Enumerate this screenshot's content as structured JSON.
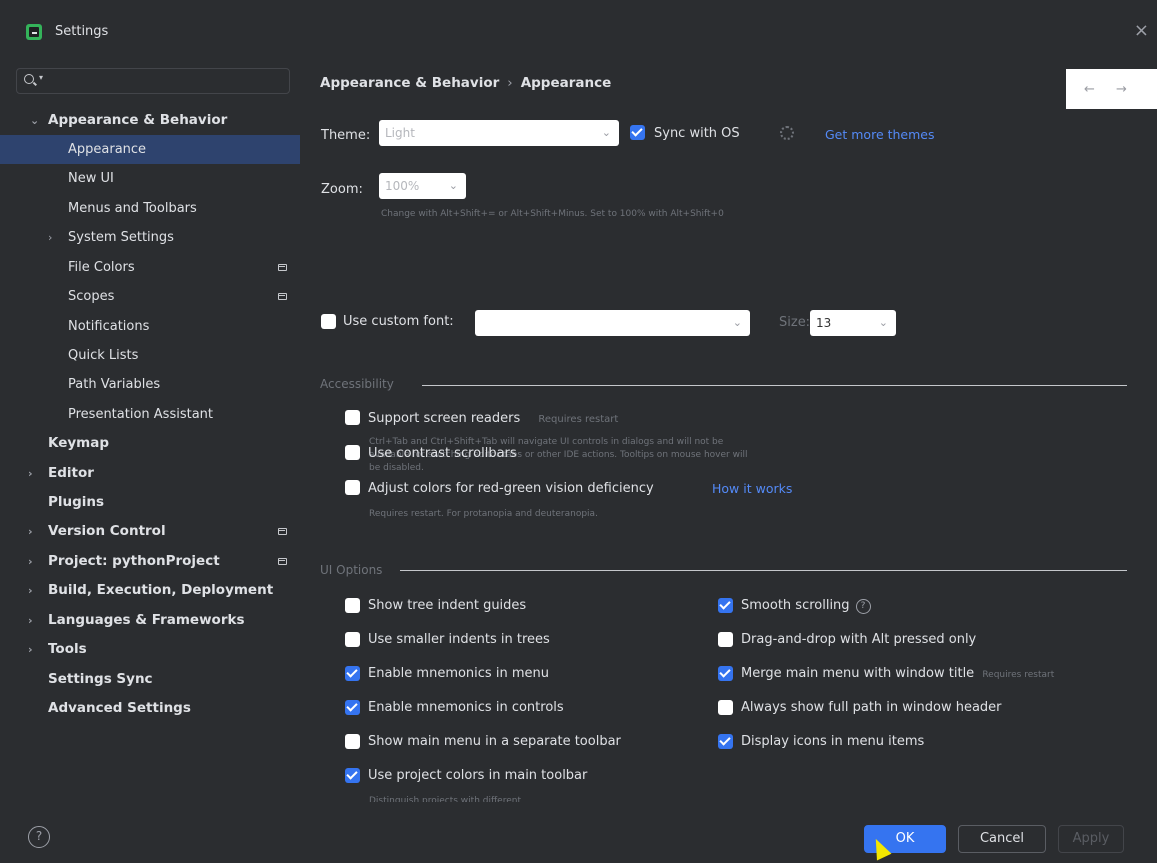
{
  "window": {
    "title": "Settings",
    "close_glyph": "×"
  },
  "sidebar": {
    "search_placeholder": "",
    "search_value": "",
    "items": [
      {
        "label": "Appearance & Behavior",
        "level": 0,
        "chevron": "expanded"
      },
      {
        "label": "Appearance",
        "level": 1,
        "selected": true
      },
      {
        "label": "New UI",
        "level": 1
      },
      {
        "label": "Menus and Toolbars",
        "level": 1
      },
      {
        "label": "System Settings",
        "level": 1,
        "chevron": "collapsed"
      },
      {
        "label": "File Colors",
        "level": 1,
        "scope_icon": true
      },
      {
        "label": "Scopes",
        "level": 1,
        "scope_icon": true
      },
      {
        "label": "Notifications",
        "level": 1
      },
      {
        "label": "Quick Lists",
        "level": 1
      },
      {
        "label": "Path Variables",
        "level": 1
      },
      {
        "label": "Presentation Assistant",
        "level": 1
      },
      {
        "label": "Keymap",
        "level": 0
      },
      {
        "label": "Editor",
        "level": 0,
        "chevron": "collapsed"
      },
      {
        "label": "Plugins",
        "level": 0
      },
      {
        "label": "Version Control",
        "level": 0,
        "chevron": "collapsed",
        "scope_icon": true
      },
      {
        "label": "Project: pythonProject",
        "level": 0,
        "chevron": "collapsed",
        "scope_icon": true
      },
      {
        "label": "Build, Execution, Deployment",
        "level": 0,
        "chevron": "collapsed"
      },
      {
        "label": "Languages & Frameworks",
        "level": 0,
        "chevron": "collapsed"
      },
      {
        "label": "Tools",
        "level": 0,
        "chevron": "collapsed"
      },
      {
        "label": "Settings Sync",
        "level": 0
      },
      {
        "label": "Advanced Settings",
        "level": 0
      }
    ],
    "help_glyph": "?"
  },
  "main": {
    "breadcrumb": {
      "parent": "Appearance & Behavior",
      "sep": "›",
      "current": "Appearance"
    },
    "nav": {
      "back": "←",
      "forward": "→"
    },
    "theme": {
      "label": "Theme:",
      "value": "Light",
      "sync_label": "Sync with OS",
      "sync_checked": true,
      "more_themes_link": "Get more themes"
    },
    "zoom": {
      "label": "Zoom:",
      "value": "100%",
      "hint": "Change with Alt+Shift+= or Alt+Shift+Minus. Set to 100% with Alt+Shift+0"
    },
    "custom_font": {
      "label": "Use custom font:",
      "checked": false,
      "value": "",
      "size_label": "Size:",
      "size_value": "13"
    },
    "accessibility": {
      "header": "Accessibility",
      "screen_readers": {
        "label": "Support screen readers",
        "note": "Requires restart",
        "checked": false,
        "hint_lines": [
          "Ctrl+Tab and Ctrl+Shift+Tab will navigate UI controls in dialogs and will not be",
          "available for switching editor tabs or other IDE actions. Tooltips on mouse hover will",
          "be disabled."
        ]
      },
      "contrast_scrollbars": {
        "label": "Use contrast scrollbars",
        "checked": false
      },
      "red_green": {
        "label": "Adjust colors for red-green vision deficiency",
        "link": "How it works",
        "checked": false,
        "hint": "Requires restart. For protanopia and deuteranopia."
      }
    },
    "ui_options": {
      "header": "UI Options",
      "left": [
        {
          "label": "Show tree indent guides",
          "checked": false
        },
        {
          "label": "Use smaller indents in trees",
          "checked": false
        },
        {
          "label": "Enable mnemonics in menu",
          "checked": true
        },
        {
          "label": "Enable mnemonics in controls",
          "checked": true
        },
        {
          "label": "Show main menu in a separate toolbar",
          "checked": false
        },
        {
          "label": "Use project colors in main toolbar",
          "checked": true
        }
      ],
      "project_colors_hint": "Distinguish projects with different",
      "right": [
        {
          "label": "Smooth scrolling",
          "checked": true,
          "help": "?"
        },
        {
          "label": "Drag-and-drop with Alt pressed only",
          "checked": false
        },
        {
          "label": "Merge main menu with window title",
          "checked": true,
          "note": "Requires restart"
        },
        {
          "label": "Always show full path in window header",
          "checked": false
        },
        {
          "label": "Display icons in menu items",
          "checked": true
        }
      ]
    }
  },
  "footer": {
    "ok": "OK",
    "cancel": "Cancel",
    "apply": "Apply"
  },
  "colors": {
    "accent": "#3574f0",
    "link": "#548af7",
    "selection": "#2e436e",
    "background": "#2b2d30"
  }
}
